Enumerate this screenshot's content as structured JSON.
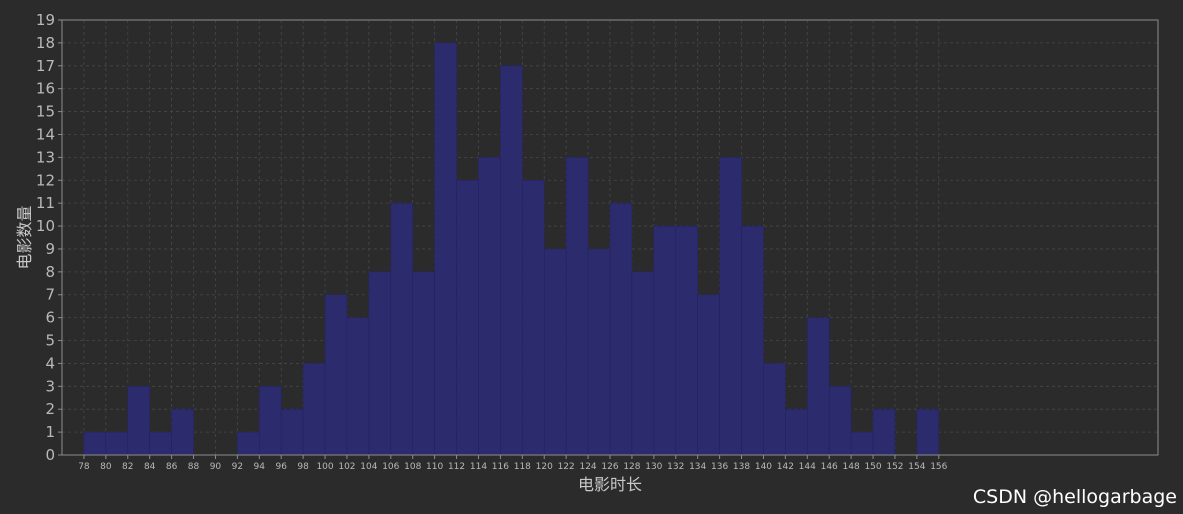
{
  "chart_data": {
    "type": "bar",
    "title": "",
    "xlabel": "电影时长",
    "ylabel": "电影数量",
    "bin_start": 78,
    "bin_width": 2,
    "x_ticks": [
      78,
      80,
      82,
      84,
      86,
      88,
      90,
      92,
      94,
      96,
      98,
      100,
      102,
      104,
      106,
      108,
      110,
      112,
      114,
      116,
      118,
      120,
      122,
      124,
      126,
      128,
      130,
      132,
      134,
      136,
      138,
      140,
      142,
      144,
      146,
      148,
      150,
      152,
      154,
      156
    ],
    "y_ticks": [
      0,
      1,
      2,
      3,
      4,
      5,
      6,
      7,
      8,
      9,
      10,
      11,
      12,
      13,
      14,
      15,
      16,
      17,
      18,
      19
    ],
    "values": [
      1,
      1,
      3,
      1,
      2,
      0,
      0,
      1,
      3,
      2,
      4,
      7,
      6,
      8,
      11,
      8,
      18,
      12,
      13,
      17,
      12,
      9,
      13,
      9,
      11,
      8,
      10,
      10,
      7,
      13,
      10,
      4,
      2,
      6,
      3,
      1,
      2,
      0,
      2
    ],
    "xlim": [
      76,
      176
    ],
    "ylim": [
      0,
      19
    ],
    "grid": true,
    "colors": {
      "background": "#2b2b2b",
      "bar_fill": "#2b2b6e",
      "bar_edge": "#222260",
      "grid": "#474747",
      "frame": "#8c8c8c"
    }
  },
  "watermark": "CSDN @hellogarbage"
}
